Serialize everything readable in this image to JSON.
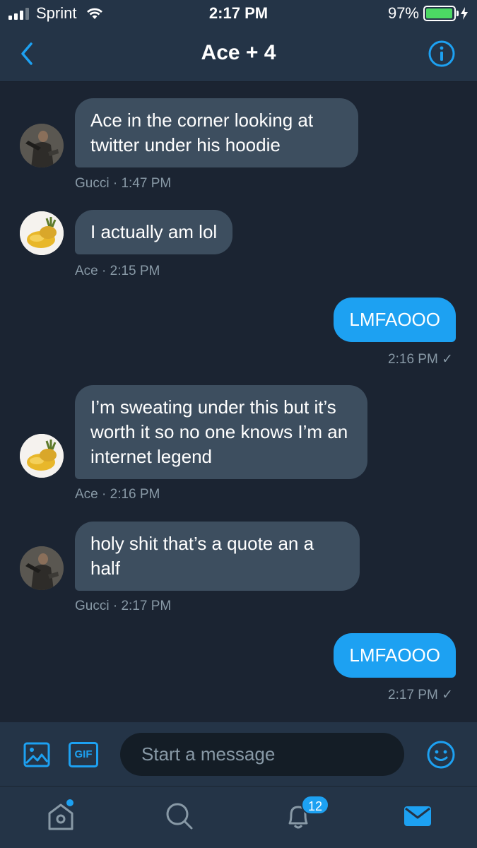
{
  "status_bar": {
    "carrier": "Sprint",
    "time": "2:17 PM",
    "battery": "97%",
    "battery_level": 0.97
  },
  "header": {
    "title": "Ace + 4",
    "back_icon": "chevron-left-icon",
    "info_icon": "info-icon"
  },
  "messages": [
    {
      "direction": "in",
      "sender": "Gucci",
      "text": "Ace in the corner looking at twitter under his hoodie",
      "meta": "Gucci · 1:47 PM"
    },
    {
      "direction": "in",
      "sender": "Ace",
      "text": "I actually am lol",
      "meta": "Ace · 2:15 PM"
    },
    {
      "direction": "out",
      "text": "LMFAOOO",
      "meta": "2:16 PM ✓"
    },
    {
      "direction": "in",
      "sender": "Ace",
      "text": "I’m sweating under this but it’s worth it so no one knows I’m an internet legend",
      "meta": "Ace · 2:16 PM"
    },
    {
      "direction": "in",
      "sender": "Gucci",
      "text": "holy shit that’s a quote an a half",
      "meta": "Gucci · 2:17 PM"
    },
    {
      "direction": "out",
      "text": "LMFAOOO",
      "meta": "2:17 PM ✓"
    }
  ],
  "compose": {
    "placeholder": "Start a message",
    "gif_label": "GIF",
    "media_icon": "image-icon",
    "emoji_icon": "emoji-icon"
  },
  "tabbar": {
    "notifications_badge": "12",
    "items": [
      "home-icon",
      "search-icon",
      "bell-icon",
      "mail-icon"
    ]
  },
  "colors": {
    "background": "#1b2432",
    "bar": "#243447",
    "incoming_bubble": "#3d4e5f",
    "outgoing_bubble": "#1da1f2",
    "meta_text": "#8899a6"
  }
}
